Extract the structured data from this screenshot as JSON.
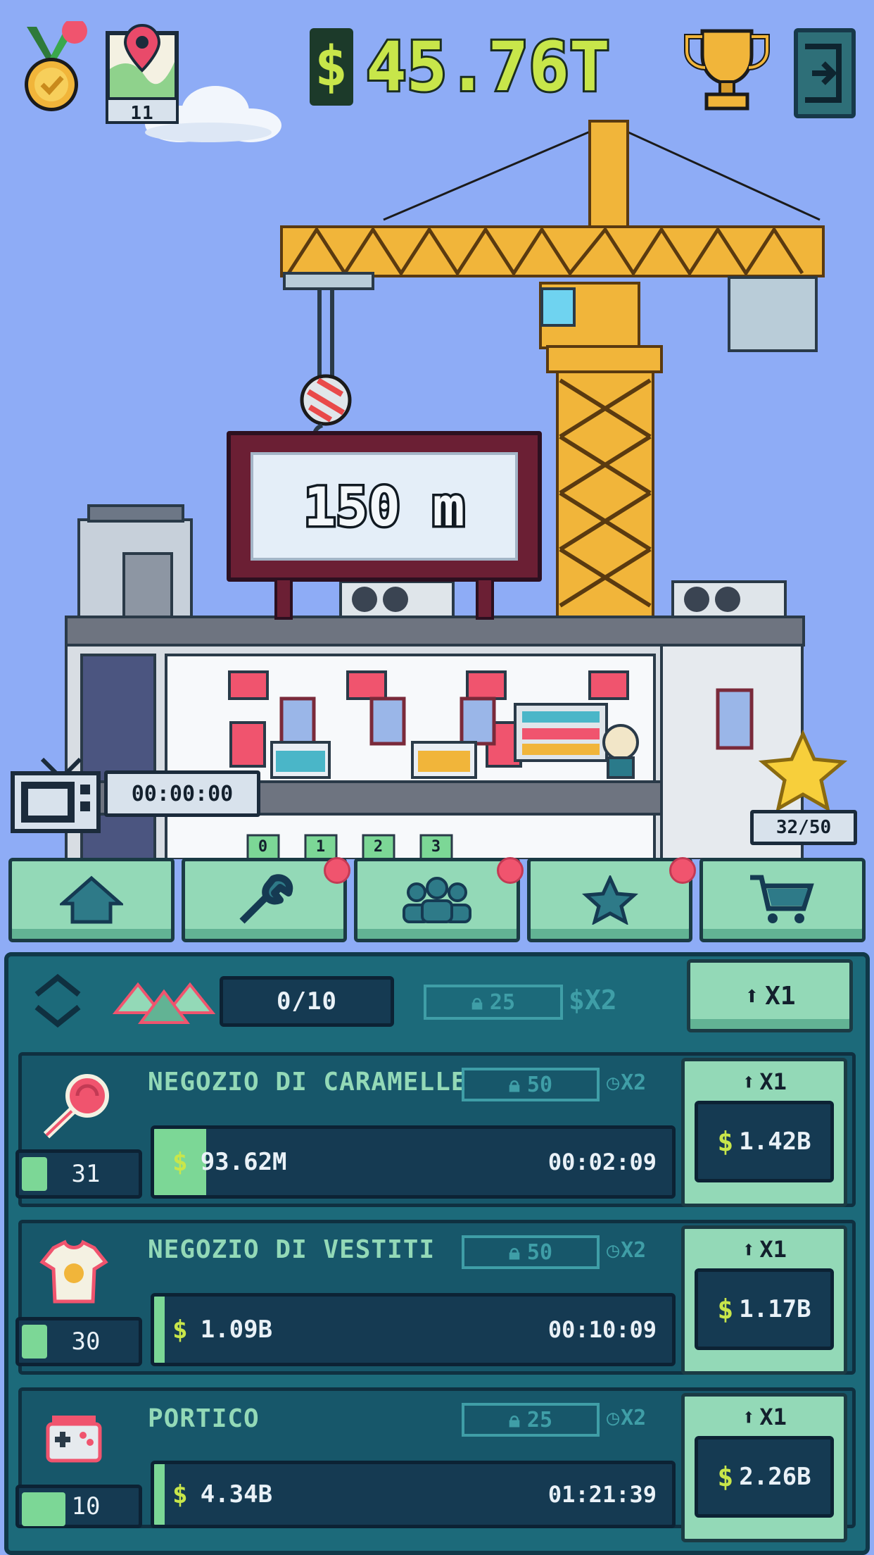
{
  "hud": {
    "money_symbol": "$",
    "money_value": "45.76T",
    "map_level": "11"
  },
  "scene": {
    "billboard_height": "150 m",
    "tv_timer": "00:00:00",
    "star_count": "32/50",
    "floor_numbers": [
      "0",
      "1",
      "2",
      "3"
    ]
  },
  "nav": {
    "tabs": [
      {
        "name": "home",
        "icon": "house-icon",
        "badge": false
      },
      {
        "name": "upgrades",
        "icon": "wrench-icon",
        "badge": true
      },
      {
        "name": "staff",
        "icon": "people-icon",
        "badge": true
      },
      {
        "name": "favorites",
        "icon": "star-icon",
        "badge": true
      },
      {
        "name": "shop",
        "icon": "cart-icon",
        "badge": false
      }
    ]
  },
  "panel": {
    "header": {
      "count": "0/10",
      "lock_value": "25",
      "multiplier": "$X2",
      "upgrade_label": "X1"
    },
    "businesses": [
      {
        "name": "NEGOZIO DI CARAMELLE",
        "icon": "lollipop-icon",
        "level": "31",
        "lock": "50",
        "time_mult": "X2",
        "earnings": "93.62M",
        "timer": "00:02:09",
        "progress": 0.1,
        "upgrade_label": "X1",
        "price": "1.42B"
      },
      {
        "name": "NEGOZIO DI VESTITI",
        "icon": "tshirt-icon",
        "level": "30",
        "lock": "50",
        "time_mult": "X2",
        "earnings": "1.09B",
        "timer": "00:10:09",
        "progress": 0.02,
        "upgrade_label": "X1",
        "price": "1.17B"
      },
      {
        "name": "PORTICO",
        "icon": "gamepad-icon",
        "level": "10",
        "lock": "25",
        "time_mult": "X2",
        "earnings": "4.34B",
        "timer": "01:21:39",
        "progress": 0.0,
        "upgrade_label": "X1",
        "price": "2.26B"
      }
    ]
  },
  "colors": {
    "sky": "#8eacf6",
    "accent_green": "#93d9b7",
    "money_yellow": "#c8e64a",
    "panel_teal": "#1c6a7a"
  }
}
